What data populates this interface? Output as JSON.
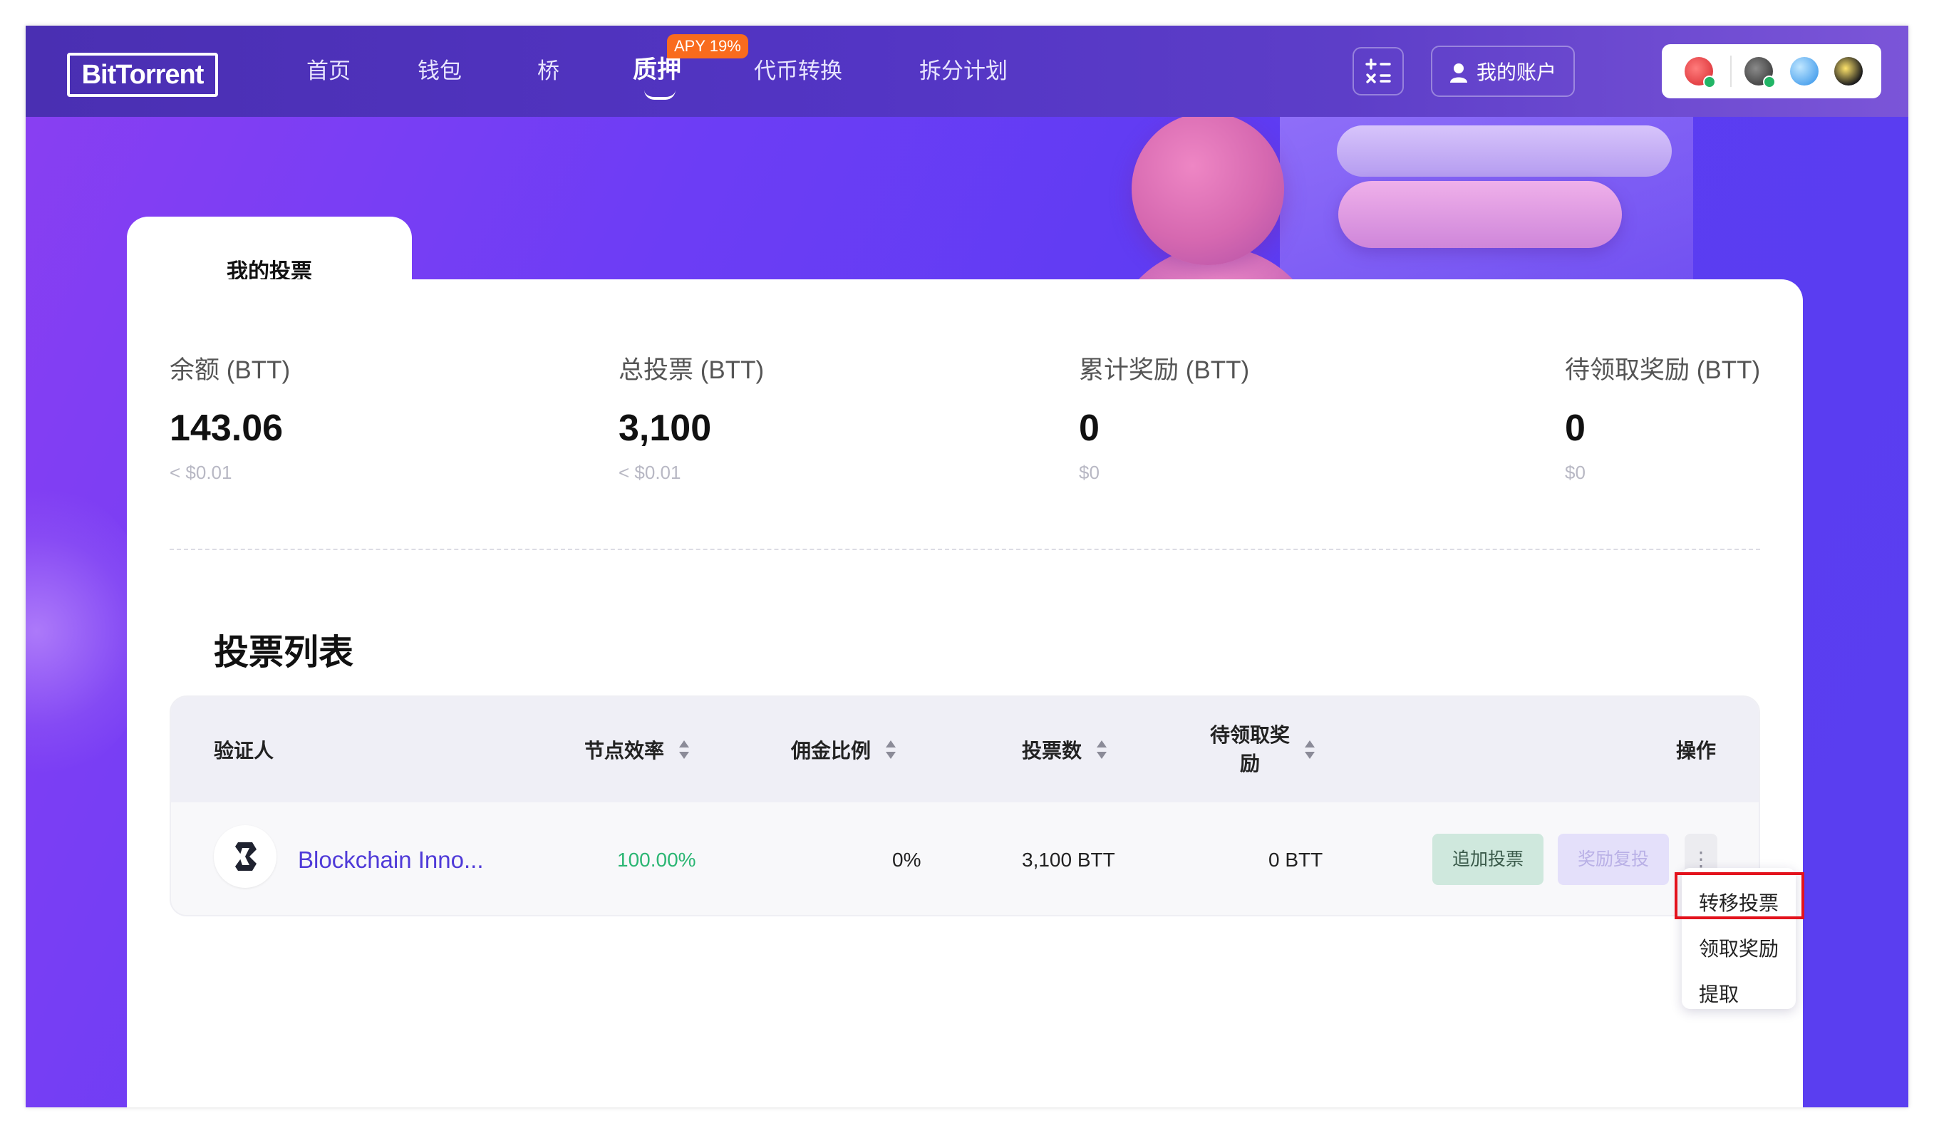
{
  "header": {
    "logo": "BitTorrent",
    "nav": [
      "首页",
      "钱包",
      "桥",
      "质押",
      "代币转换",
      "拆分计划"
    ],
    "active_nav": "质押",
    "apy_badge": "APY 19%",
    "account_label": "我的账户",
    "wallet_icons": [
      "red-coin-icon",
      "dark-coin-icon",
      "blue-crystal-icon",
      "gold-coin-icon"
    ]
  },
  "tab": {
    "label": "我的投票"
  },
  "stats": [
    {
      "label": "余额 (BTT)",
      "value": "143.06",
      "sub": "< $0.01"
    },
    {
      "label": "总投票 (BTT)",
      "value": "3,100",
      "sub": "< $0.01"
    },
    {
      "label": "累计奖励 (BTT)",
      "value": "0",
      "sub": "$0"
    },
    {
      "label": "待领取奖励 (BTT)",
      "value": "0",
      "sub": "$0"
    }
  ],
  "vote_list": {
    "title": "投票列表",
    "headers": {
      "validator": "验证人",
      "efficiency": "节点效率",
      "commission": "佣金比例",
      "votes": "投票数",
      "pending_line1": "待领取奖",
      "pending_line2": "励",
      "actions": "操作"
    },
    "rows": [
      {
        "validator": "Blockchain Inno...",
        "efficiency": "100.00%",
        "commission": "0%",
        "votes": "3,100 BTT",
        "pending": "0 BTT",
        "add_vote": "追加投票",
        "reinvest": "奖励复投",
        "more": "⋮"
      }
    ]
  },
  "dropdown_menu": [
    "转移投票",
    "领取奖励",
    "提取"
  ],
  "colors": {
    "accent": "#5b3cf2",
    "positive": "#2bb673",
    "highlight": "#e3121c",
    "apy_badge": "#f96b1d"
  }
}
